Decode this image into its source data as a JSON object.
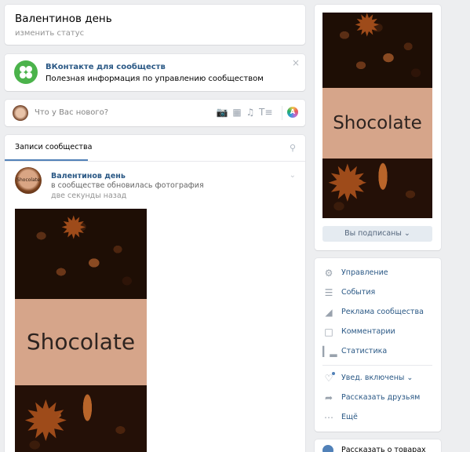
{
  "header": {
    "title": "Валентинов день",
    "status_link": "изменить статус"
  },
  "promo": {
    "title": "ВКонтакте для сообществ",
    "subtitle": "Полезная информация по управлению сообществом",
    "close": "×"
  },
  "composer": {
    "placeholder": "Что у Вас нового?",
    "icons": [
      "camera-icon",
      "video-icon",
      "music-icon",
      "text-format-icon",
      "color-palette-icon"
    ],
    "palette_letter": "A"
  },
  "wall": {
    "tab_label": "Записи сообщества",
    "post": {
      "avatar_text": "Shocolate",
      "author": "Валентинов день",
      "action": "в сообществе обновилась фотография",
      "time": "две секунды назад",
      "photo_text": "Shocolate"
    }
  },
  "cover": {
    "photo_text": "Shocolate",
    "subscribe_label": "Вы подписаны ⌄"
  },
  "menu": {
    "items": [
      {
        "label": "Управление",
        "icon": "gear-icon"
      },
      {
        "label": "События",
        "icon": "list-icon"
      },
      {
        "label": "Реклама сообщества",
        "icon": "megaphone-icon"
      },
      {
        "label": "Комментарии",
        "icon": "comment-icon"
      },
      {
        "label": "Статистика",
        "icon": "stats-icon"
      },
      {
        "label": "Увед. включены ⌄",
        "icon": "bell-icon"
      },
      {
        "label": "Рассказать друзьям",
        "icon": "share-icon"
      },
      {
        "label": "Ещё",
        "icon": "more-icon"
      }
    ]
  },
  "bottom": {
    "label": "Рассказать о товарах или"
  },
  "colors": {
    "link": "#2a5885",
    "accent": "#5181b8",
    "background": "#edeef0"
  }
}
